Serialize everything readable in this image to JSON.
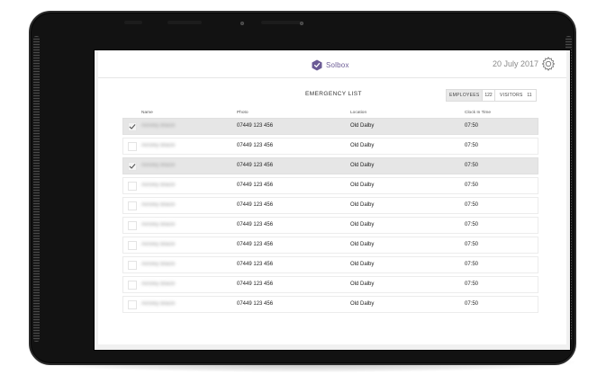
{
  "header": {
    "brand_name": "Solbox",
    "date": "20 July 2017"
  },
  "list": {
    "title": "EMERGENCY LIST",
    "toggle": {
      "employees_label": "EMPLOYEES",
      "employees_count": "122",
      "visitors_label": "VISITORS",
      "visitors_count": "11"
    },
    "columns": {
      "name": "Name",
      "phone": "Photo",
      "location": "Location",
      "clock_in": "Clock In Time"
    },
    "rows": [
      {
        "name": "Ainsley Blaize",
        "phone": "07449 123 456",
        "location": "Old Dalby",
        "time": "07:50",
        "checked": true
      },
      {
        "name": "Ainsley Blaize",
        "phone": "07449 123 456",
        "location": "Old Dalby",
        "time": "07:50",
        "checked": false
      },
      {
        "name": "Ainsley Blaize",
        "phone": "07449 123 456",
        "location": "Old Dalby",
        "time": "07:50",
        "checked": true
      },
      {
        "name": "Ainsley Blaize",
        "phone": "07449 123 456",
        "location": "Old Dalby",
        "time": "07:50",
        "checked": false
      },
      {
        "name": "Ainsley Blaize",
        "phone": "07449 123 456",
        "location": "Old Dalby",
        "time": "07:50",
        "checked": false
      },
      {
        "name": "Ainsley Blaize",
        "phone": "07449 123 456",
        "location": "Old Dalby",
        "time": "07:50",
        "checked": false
      },
      {
        "name": "Ainsley Blaize",
        "phone": "07449 123 456",
        "location": "Old Dalby",
        "time": "07:50",
        "checked": false
      },
      {
        "name": "Ainsley Blaize",
        "phone": "07449 123 456",
        "location": "Old Dalby",
        "time": "07:50",
        "checked": false
      },
      {
        "name": "Ainsley Blaize",
        "phone": "07449 123 456",
        "location": "Old Dalby",
        "time": "07:50",
        "checked": false
      },
      {
        "name": "Ainsley Blaize",
        "phone": "07449 123 456",
        "location": "Old Dalby",
        "time": "07:50",
        "checked": false
      }
    ]
  },
  "colors": {
    "brand": "#6b5b95",
    "selected_row": "#e6e6e6",
    "frame": "#121212"
  },
  "icons": [
    "solbox-logo-icon",
    "gear-icon",
    "checkmark-icon"
  ]
}
